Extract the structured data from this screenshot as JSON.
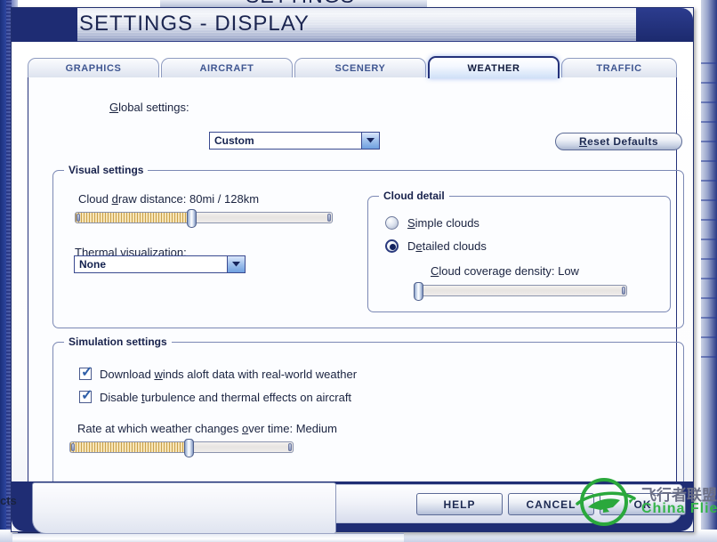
{
  "desktop": {
    "background_window_title": "SETTINGS",
    "background_bottom_text": "cts"
  },
  "window": {
    "title": "SETTINGS - DISPLAY"
  },
  "tabs": [
    {
      "label": "GRAPHICS",
      "active": false
    },
    {
      "label": "AIRCRAFT",
      "active": false
    },
    {
      "label": "SCENERY",
      "active": false
    },
    {
      "label": "WEATHER",
      "active": true
    },
    {
      "label": "TRAFFIC",
      "active": false
    }
  ],
  "toolbar": {
    "global_label": "Global settings:",
    "global_value": "Custom",
    "reset_label": "Reset Defaults"
  },
  "visual_settings": {
    "group_title": "Visual settings",
    "cloud_draw_distance_label": "Cloud draw distance: 80mi / 128km",
    "cloud_draw_distance_value": "80mi / 128km",
    "cloud_draw_distance_percent": 45,
    "thermal_label": "Thermal visualization:",
    "thermal_value": "None"
  },
  "cloud_detail": {
    "group_title": "Cloud detail",
    "options": [
      {
        "label": "Simple clouds",
        "selected": false
      },
      {
        "label": "Detailed clouds",
        "selected": true
      }
    ],
    "coverage_label": "Cloud coverage density: Low",
    "coverage_value": "Low",
    "coverage_percent": 0
  },
  "simulation_settings": {
    "group_title": "Simulation settings",
    "checkboxes": [
      {
        "label": "Download winds aloft data with real-world weather",
        "checked": true
      },
      {
        "label": "Disable turbulence and thermal effects on aircraft",
        "checked": true
      }
    ],
    "rate_label": "Rate at which weather changes over time: Medium",
    "rate_value": "Medium",
    "rate_percent": 53
  },
  "footer": {
    "buttons": [
      {
        "label": "HELP"
      },
      {
        "label": "CANCEL"
      },
      {
        "label": "OK"
      }
    ]
  },
  "watermark": {
    "chinese": "飞行者联盟",
    "english": "China Flier"
  },
  "colors": {
    "titlebar_blue": "#1e2c73",
    "accent_border": "#24317a",
    "slider_fill": "#caa14a",
    "watermark_green": "#35b44a"
  }
}
